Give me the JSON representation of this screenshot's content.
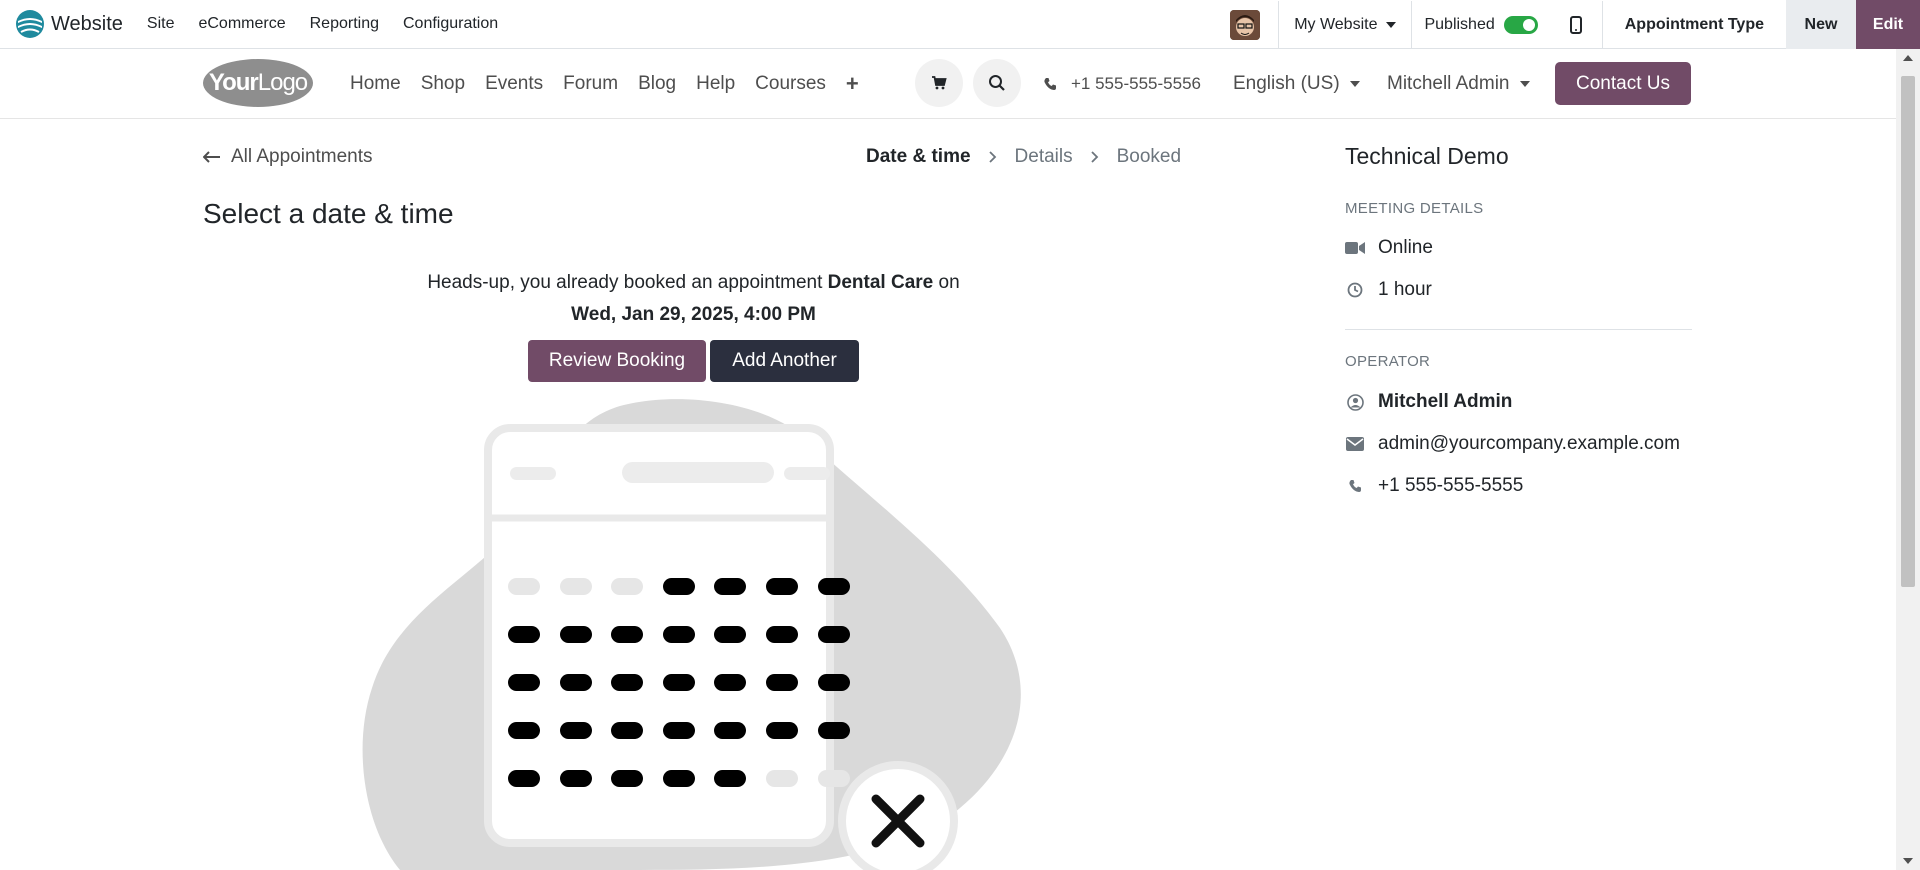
{
  "topbar": {
    "app_name": "Website",
    "menu": [
      "Site",
      "eCommerce",
      "Reporting",
      "Configuration"
    ],
    "my_website": "My Website",
    "published": "Published",
    "appointment_type": "Appointment Type",
    "new": "New",
    "edit": "Edit"
  },
  "header": {
    "logo_bold": "Your",
    "logo_light": "Logo",
    "nav": [
      "Home",
      "Shop",
      "Events",
      "Forum",
      "Blog",
      "Help",
      "Courses"
    ],
    "plus": "+",
    "phone": "+1 555-555-5556",
    "language": "English (US)",
    "user": "Mitchell Admin",
    "contact": "Contact Us"
  },
  "main": {
    "back": "All Appointments",
    "steps": [
      "Date & time",
      "Details",
      "Booked"
    ],
    "title": "Select a date & time",
    "alert_prefix": "Heads-up, you already booked an appointment ",
    "alert_appointment": "Dental Care",
    "alert_suffix": " on",
    "alert_datetime": "Wed, Jan 29, 2025, 4:00 PM",
    "review_button": "Review Booking",
    "another_button": "Add Another"
  },
  "sidebar": {
    "title": "Technical Demo",
    "meeting_heading": "MEETING DETAILS",
    "location": "Online",
    "duration": "1 hour",
    "operator_heading": "OPERATOR",
    "operator_name": "Mitchell Admin",
    "operator_email": "admin@yourcompany.example.com",
    "operator_phone": "+1 555-555-5555"
  },
  "colors": {
    "brand": "#714b67",
    "dark_button": "#2b2f3e",
    "toggle_on": "#28a745"
  }
}
